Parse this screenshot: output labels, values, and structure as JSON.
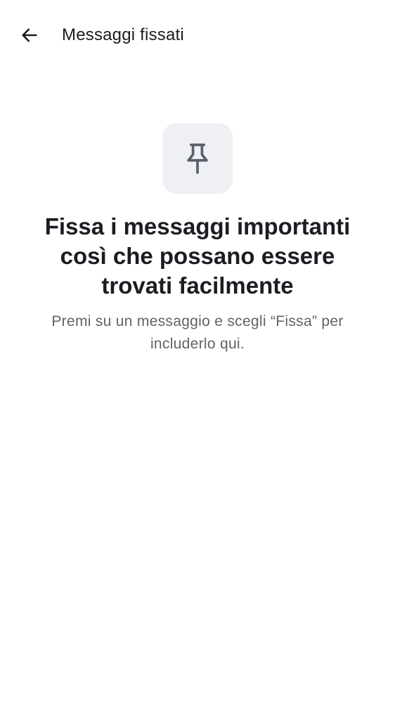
{
  "header": {
    "back_icon": "arrow-left-icon",
    "title": "Messaggi fissati"
  },
  "empty_state": {
    "icon": "pin-icon",
    "headline": "Fissa i messaggi importanti così che possano essere trovati facilmente",
    "description": "Premi su un messaggio e scegli “Fissa” per includerlo qui."
  },
  "colors": {
    "background": "#ffffff",
    "text_primary": "#1c1d22",
    "text_secondary": "#5f6368",
    "icon_tile": "#eff0f4",
    "icon": "#5b5f6b"
  }
}
